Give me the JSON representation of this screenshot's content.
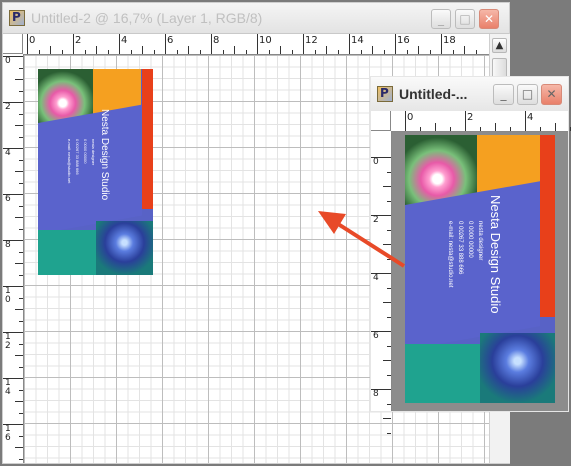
{
  "main_window": {
    "title": "Untitled-2 @ 16,7% (Layer 1, RGB/8)",
    "buttons": {
      "minimize": "_",
      "maximize": "□",
      "close": "✕"
    },
    "ruler_top_labels": [
      "0",
      "2",
      "4",
      "6",
      "8",
      "10",
      "12",
      "14",
      "16",
      "18"
    ],
    "ruler_left_labels": [
      "0",
      "2",
      "4",
      "6",
      "8",
      "1 0",
      "1 2",
      "1 4",
      "1 6"
    ],
    "scroll_up": "▲"
  },
  "small_window": {
    "title": "Untitled-...",
    "buttons": {
      "minimize": "_",
      "maximize": "□",
      "close": "✕"
    },
    "ruler_top_labels": [
      "0",
      "2",
      "4"
    ],
    "ruler_left_labels": [
      "0",
      "2",
      "4",
      "6",
      "8"
    ]
  },
  "card": {
    "brand": "Nesta Design Studio",
    "info_lines": [
      "nesta designer",
      "0 0000 00000",
      "0 00267 33 888 666",
      "e-mail: nesta@studio.net"
    ]
  },
  "colors": {
    "orange": "#f5a020",
    "red": "#e8401a",
    "blue": "#5a63cc",
    "teal": "#1fa38f",
    "arrow": "#e84a28"
  },
  "icons": {
    "app_icon": "photoshop-document-icon",
    "arrow": "pointer-arrow-icon"
  }
}
